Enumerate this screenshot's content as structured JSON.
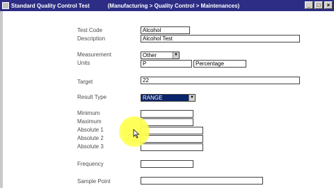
{
  "window": {
    "app_title": "Standard Quality Control Test",
    "path": "(Manufacturing > Quality Control > Maintenances)",
    "controls": {
      "minimize": "_",
      "maximize": "□",
      "close": "×"
    }
  },
  "form": {
    "test_code": {
      "label": "Test Code",
      "value": "Alcohol"
    },
    "description": {
      "label": "Description",
      "value": "Alcohol Test"
    },
    "measurement": {
      "label": "Measurement",
      "value": "Other"
    },
    "units": {
      "label": "Units",
      "code": "P",
      "name": "Percentage"
    },
    "target": {
      "label": "Target",
      "value": "22"
    },
    "result_type": {
      "label": "Result Type",
      "value": "RANGE"
    },
    "minimum": {
      "label": "Minimum",
      "value": ""
    },
    "maximum": {
      "label": "Maximum",
      "value": ""
    },
    "absolute_1": {
      "label": "Absolute 1",
      "value": ""
    },
    "absolute_2": {
      "label": "Absolute 2",
      "value": ""
    },
    "absolute_3": {
      "label": "Absolute 3",
      "value": ""
    },
    "frequency": {
      "label": "Frequency",
      "value": ""
    },
    "sample_point": {
      "label": "Sample Point",
      "value": ""
    }
  },
  "icons": {
    "title_icon": "window-icon",
    "cursor": "mouse-pointer-icon",
    "dropdown": "chevron-down-icon"
  },
  "colors": {
    "titlebar": "#2d2d86",
    "highlight": "#0a246a",
    "label": "#4d4d4d",
    "cursor_spotlight": "#ffff50"
  }
}
